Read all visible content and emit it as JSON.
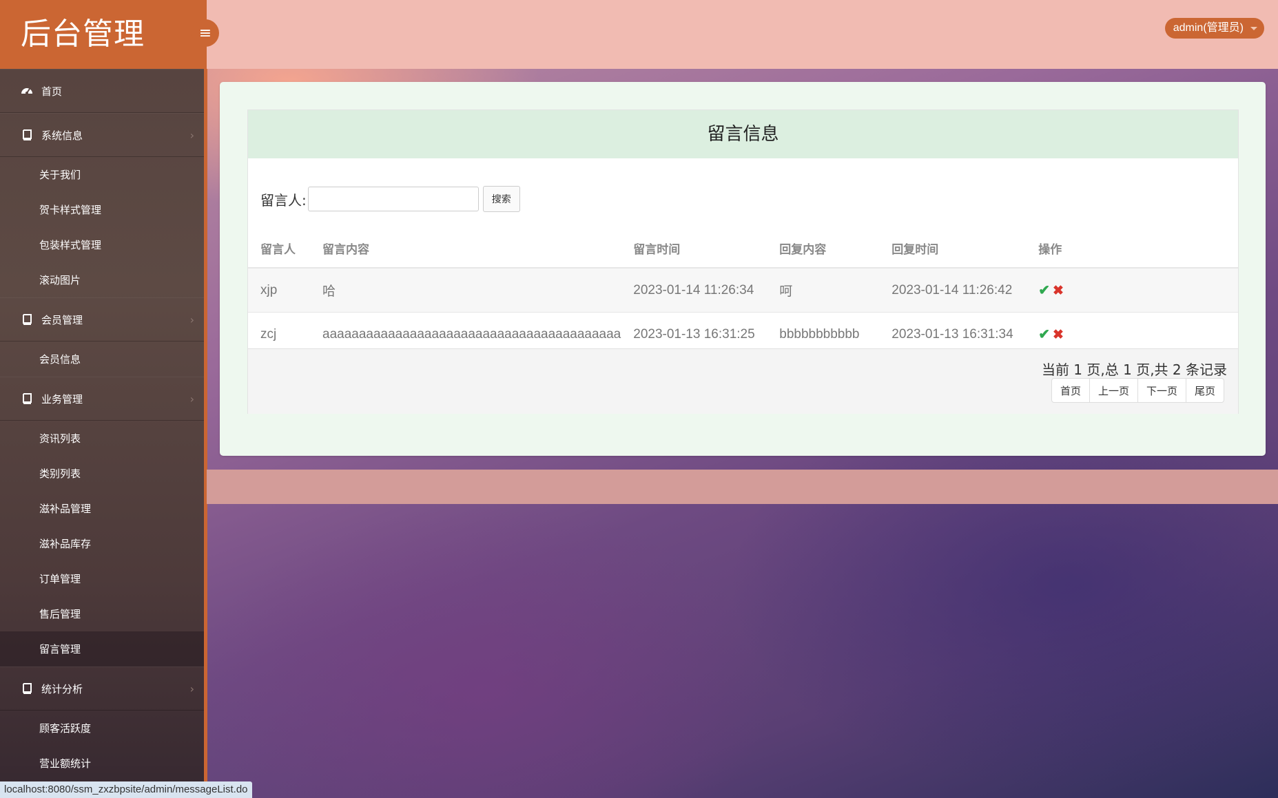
{
  "header": {
    "brand": "后台管理",
    "user": "admin(管理员)"
  },
  "sidebar": {
    "home": "首页",
    "groups": [
      {
        "label": "系统信息",
        "items": [
          "关于我们",
          "贺卡样式管理",
          "包装样式管理",
          "滚动图片"
        ]
      },
      {
        "label": "会员管理",
        "items": [
          "会员信息"
        ]
      },
      {
        "label": "业务管理",
        "items": [
          "资讯列表",
          "类别列表",
          "滋补品管理",
          "滋补品库存",
          "订单管理",
          "售后管理",
          "留言管理"
        ]
      },
      {
        "label": "统计分析",
        "items": [
          "顾客活跃度",
          "营业额统计"
        ]
      }
    ],
    "active_item": "留言管理"
  },
  "main": {
    "title": "留言信息",
    "search": {
      "label": "留言人:",
      "value": "",
      "button": "搜索"
    },
    "table": {
      "columns": [
        "留言人",
        "留言内容",
        "留言时间",
        "回复内容",
        "回复时间",
        "操作"
      ],
      "rows": [
        {
          "user": "xjp",
          "content": "哈",
          "time": "2023-01-14 11:26:34",
          "reply": "呵",
          "reply_time": "2023-01-14 11:26:42"
        },
        {
          "user": "zcj",
          "content": "aaaaaaaaaaaaaaaaaaaaaaaaaaaaaaaaaaaaaaaaa",
          "time": "2023-01-13 16:31:25",
          "reply": "bbbbbbbbbbb",
          "reply_time": "2023-01-13 16:31:34"
        }
      ]
    },
    "pagination": {
      "info": "当前 1 页,总 1 页,共 2 条记录",
      "buttons": [
        "首页",
        "上一页",
        "下一页",
        "尾页"
      ]
    }
  },
  "status_url": "localhost:8080/ssm_zxzbpsite/admin/messageList.do",
  "colors": {
    "accent": "#cb6633",
    "ok": "#2fa84f",
    "delete": "#d9342b"
  }
}
